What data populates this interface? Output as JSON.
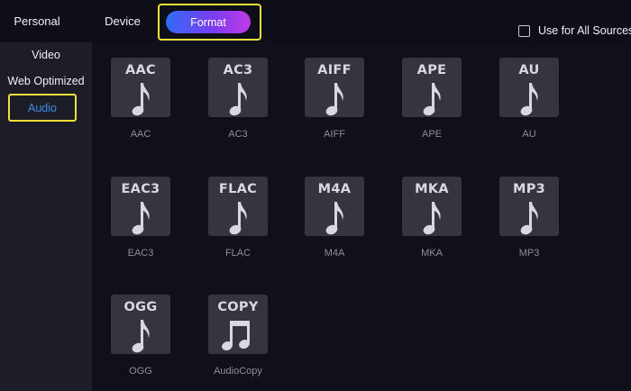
{
  "top_tabs": {
    "personal": "Personal",
    "device": "Device",
    "format": "Format"
  },
  "use_all_sources": {
    "label": "Use for All Sources",
    "checked": false
  },
  "sidebar": {
    "items": [
      "Video",
      "Web Optimized",
      "Audio"
    ],
    "selected": "Audio"
  },
  "colors": {
    "highlight_outline": "#f3e13a",
    "selected_text": "#3b8fe8",
    "format_gradient": [
      "#2f6cf6",
      "#c13ae8"
    ]
  },
  "formats": [
    {
      "code": "AAC",
      "name": "AAC",
      "icon": "music-note-icon"
    },
    {
      "code": "AC3",
      "name": "AC3",
      "icon": "music-note-icon"
    },
    {
      "code": "AIFF",
      "name": "AIFF",
      "icon": "music-note-icon"
    },
    {
      "code": "APE",
      "name": "APE",
      "icon": "music-note-icon"
    },
    {
      "code": "AU",
      "name": "AU",
      "icon": "music-note-icon"
    },
    {
      "code": "EAC3",
      "name": "EAC3",
      "icon": "music-note-icon"
    },
    {
      "code": "FLAC",
      "name": "FLAC",
      "icon": "music-note-icon"
    },
    {
      "code": "M4A",
      "name": "M4A",
      "icon": "music-note-icon"
    },
    {
      "code": "MKA",
      "name": "MKA",
      "icon": "music-note-icon"
    },
    {
      "code": "MP3",
      "name": "MP3",
      "icon": "music-note-icon"
    },
    {
      "code": "OGG",
      "name": "OGG",
      "icon": "music-note-icon"
    },
    {
      "code": "COPY",
      "name": "AudioCopy",
      "icon": "beamed-notes-icon"
    }
  ]
}
